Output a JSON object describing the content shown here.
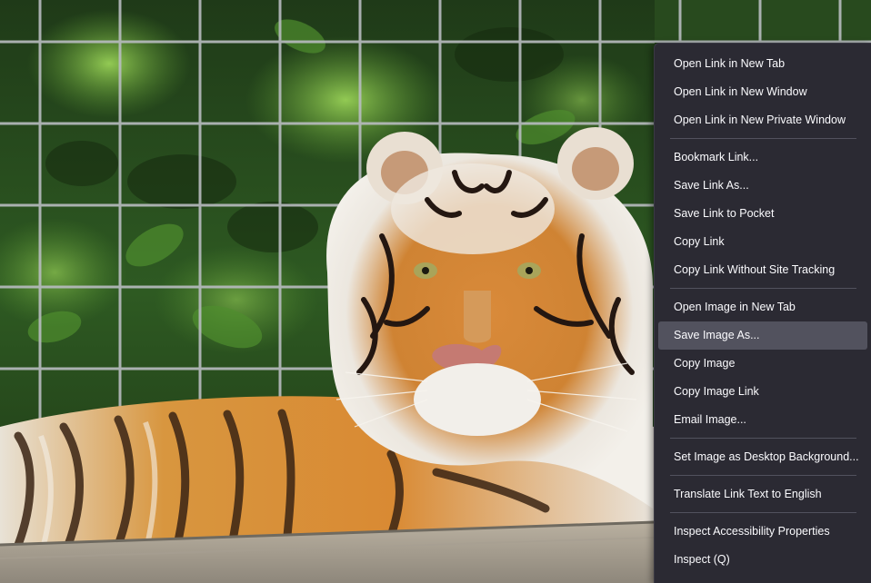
{
  "context_menu": {
    "groups": [
      [
        {
          "label": "Open Link in New Tab"
        },
        {
          "label": "Open Link in New Window"
        },
        {
          "label": "Open Link in New Private Window"
        }
      ],
      [
        {
          "label": "Bookmark Link..."
        },
        {
          "label": "Save Link As..."
        },
        {
          "label": "Save Link to Pocket"
        },
        {
          "label": "Copy Link"
        },
        {
          "label": "Copy Link Without Site Tracking"
        }
      ],
      [
        {
          "label": "Open Image in New Tab"
        },
        {
          "label": "Save Image As...",
          "highlighted": true
        },
        {
          "label": "Copy Image"
        },
        {
          "label": "Copy Image Link"
        },
        {
          "label": "Email Image..."
        }
      ],
      [
        {
          "label": "Set Image as Desktop Background..."
        }
      ],
      [
        {
          "label": "Translate Link Text to English"
        }
      ],
      [
        {
          "label": "Inspect Accessibility Properties"
        },
        {
          "label": "Inspect (Q)"
        }
      ]
    ]
  },
  "colors": {
    "menu_background": "#2b2a33",
    "menu_text": "#fbfbfe",
    "menu_highlight": "#52525e"
  }
}
